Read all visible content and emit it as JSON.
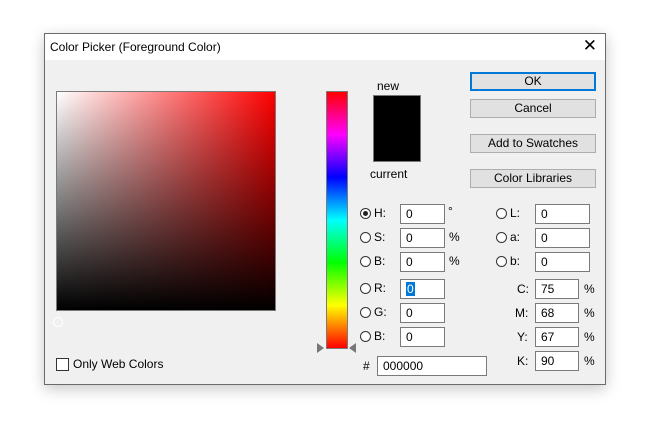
{
  "window": {
    "title": "Color Picker (Foreground Color)",
    "close_glyph": "✕"
  },
  "colors": {
    "new_swatch": "#000000",
    "current_swatch": "#000000",
    "hue_max": "#ff0000",
    "accent": "#0078d7"
  },
  "preview": {
    "new_label": "new",
    "current_label": "current"
  },
  "buttons": {
    "ok": "OK",
    "cancel": "Cancel",
    "add_to_swatches": "Add to Swatches",
    "color_libraries": "Color Libraries"
  },
  "hsb": {
    "h": {
      "label": "H:",
      "value": "0",
      "unit": "°",
      "selected": true
    },
    "s": {
      "label": "S:",
      "value": "0",
      "unit": "%"
    },
    "b": {
      "label": "B:",
      "value": "0",
      "unit": "%"
    }
  },
  "rgb": {
    "r": {
      "label": "R:",
      "value": "0"
    },
    "g": {
      "label": "G:",
      "value": "0"
    },
    "b": {
      "label": "B:",
      "value": "0"
    }
  },
  "lab": {
    "l": {
      "label": "L:",
      "value": "0"
    },
    "a": {
      "label": "a:",
      "value": "0"
    },
    "b": {
      "label": "b:",
      "value": "0"
    }
  },
  "cmyk": {
    "c": {
      "label": "C:",
      "value": "75",
      "unit": "%"
    },
    "m": {
      "label": "M:",
      "value": "68",
      "unit": "%"
    },
    "y": {
      "label": "Y:",
      "value": "67",
      "unit": "%"
    },
    "k": {
      "label": "K:",
      "value": "90",
      "unit": "%"
    }
  },
  "hex": {
    "label": "#",
    "value": "000000"
  },
  "web_colors": {
    "label": "Only Web Colors",
    "checked": false
  }
}
